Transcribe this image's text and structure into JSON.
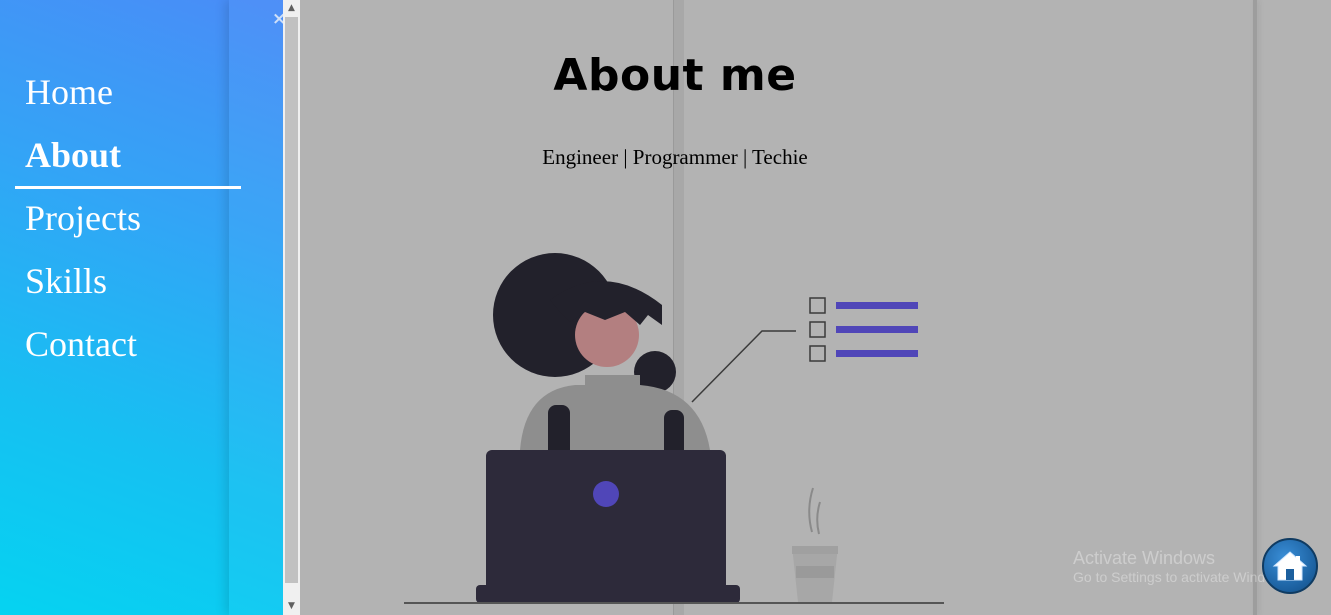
{
  "sidebar": {
    "close_icon": "×",
    "items": [
      {
        "label": "Home"
      },
      {
        "label": "About"
      },
      {
        "label": "Projects"
      },
      {
        "label": "Skills"
      },
      {
        "label": "Contact"
      }
    ],
    "active": "About"
  },
  "main": {
    "title": "About me",
    "subtitle": "Engineer | Programmer | Techie"
  },
  "watermark": {
    "title": "Activate Windows",
    "subtitle": "Go to Settings to activate Windows."
  },
  "colors": {
    "accent_purple": "#5046b8",
    "sidebar_gradient_top": "#4a8cf7",
    "sidebar_gradient_bottom": "#05d3f1"
  },
  "icons": [
    "close-icon",
    "home-icon"
  ]
}
